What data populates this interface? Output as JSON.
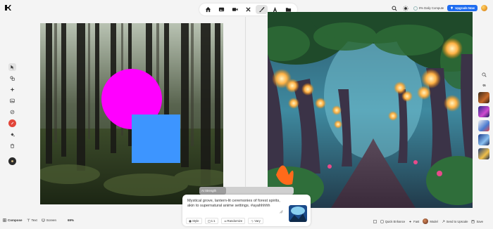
{
  "toolbar": {
    "tools": [
      {
        "name": "home-icon",
        "active": false
      },
      {
        "name": "image-icon",
        "active": false
      },
      {
        "name": "video-icon",
        "active": false
      },
      {
        "name": "crop-icon",
        "active": false
      },
      {
        "name": "brush-icon",
        "active": true
      },
      {
        "name": "text-icon",
        "active": false
      },
      {
        "name": "folder-icon",
        "active": false
      }
    ]
  },
  "top_right": {
    "compute_label": "0% Daily Compute",
    "upgrade_label": "Upgrade Now"
  },
  "left_rail": {
    "tools": [
      "select-icon",
      "shapes-icon",
      "sparkle-icon",
      "image-icon",
      "pen-icon",
      "color-icon",
      "fill-icon",
      "trash-icon",
      "settings-icon"
    ]
  },
  "canvas": {
    "circle_color": "#ff00ff",
    "square_color": "#3d95ff"
  },
  "prompt": {
    "strength_label": "AI Strength",
    "strength_value": 0.28,
    "text": "Mystical grove, lantern-lit ceremonies of forest spirits, akin to supernatural anime settings. #ayahhhhh",
    "style_label": "Style",
    "ratio_label": "1:1",
    "randomize_label": "Randomize",
    "vary_label": "Vary"
  },
  "bottom_left": {
    "compose_label": "Compose",
    "text_label": "Text",
    "screen_label": "Screen",
    "zoom": "69%"
  },
  "bottom_right": {
    "quick_enhance_label": "Quick Enhance",
    "fast_label": "Fast",
    "model_label": "Model",
    "send_label": "Send to Upscale",
    "save_label": "Save"
  },
  "colors": {
    "accent": "#1e6cf0",
    "record": "#e2463a"
  }
}
